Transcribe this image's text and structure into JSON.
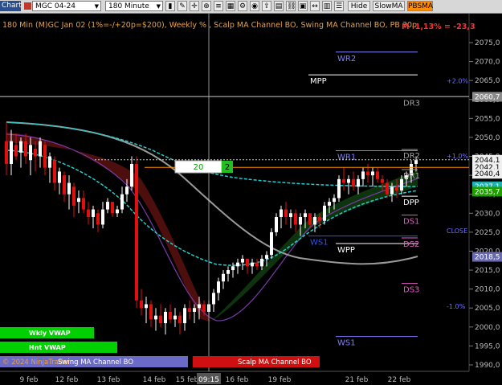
{
  "toolbar": {
    "tab_label": "Chart",
    "instrument": "MGC 04-24",
    "interval": "180 Minute",
    "buttons": [
      "Hide",
      "SlowMA",
      "PBSMA"
    ],
    "active_button": "PBSMA"
  },
  "chart_header": {
    "title": "180 Min (M)GC Jan 02 (1%=-/+20p=$200), Weekly % , Scalp MA Channel BO, Swing MA Channel BO, PB 30p",
    "status": "M -1,13% = -23,3"
  },
  "price_axis": {
    "ticks": [
      "2075,0",
      "2070,0",
      "2065,0",
      "2060,0",
      "2055,0",
      "2050,0",
      "2045,0",
      "2040,0",
      "2035,0",
      "2030,0",
      "2025,0",
      "2020,0",
      "2015,0",
      "2010,0",
      "2005,0",
      "2000,0",
      "1995,0",
      "1990,0"
    ],
    "tick_values": [
      2075,
      2070,
      2065,
      2060,
      2055,
      2050,
      2045,
      2040,
      2035,
      2030,
      2025,
      2020,
      2015,
      2010,
      2005,
      2000,
      1995,
      1990
    ],
    "markers": [
      {
        "label": "2060,7",
        "value": 2060.7,
        "color": "#b0b0b0"
      },
      {
        "label": "2044,1",
        "value": 2044.1,
        "color": "#ffffff"
      },
      {
        "label": "2042,1",
        "value": 2042.1,
        "color": "#ffffff"
      },
      {
        "label": "2040,4",
        "value": 2040.4,
        "color": "#ffffff"
      },
      {
        "label": "2037,1",
        "value": 2037.1,
        "color": "#20c0c0"
      },
      {
        "label": "2035,7",
        "value": 2035.7,
        "color": "#20c000"
      },
      {
        "label": "2018,5",
        "value": 2018.5,
        "color": "#8080c0"
      }
    ]
  },
  "time_axis": {
    "labels": [
      "9 feb",
      "12 feb",
      "13 feb",
      "14 feb",
      "15 feb",
      "16 feb",
      "19 feb",
      "21 feb",
      "22 feb"
    ],
    "crosshair_time": "09:15"
  },
  "levels": [
    {
      "label": "WR2",
      "value": 2072.5
    },
    {
      "label": "MPP",
      "value": 2066.5
    },
    {
      "label": "DR3",
      "value": 2060.7
    },
    {
      "label": "WR1",
      "value": 2046.5
    },
    {
      "label": "DR2",
      "value": 2046.8
    },
    {
      "label": "DR1",
      "value": 2041.5
    },
    {
      "label": "DPP",
      "value": 2034.5
    },
    {
      "label": "DS1",
      "value": 2029.5
    },
    {
      "label": "WS1",
      "value": 2024.0
    },
    {
      "label": "WPP",
      "value": 2022.0
    },
    {
      "label": "DS2",
      "value": 2023.5
    },
    {
      "label": "DS3",
      "value": 2011.5
    },
    {
      "label": "WS1",
      "value": 1997.5
    }
  ],
  "percent_labels": [
    {
      "label": "+2.0%",
      "value": 2064.3
    },
    {
      "label": "+1,0%",
      "value": 2044.5
    },
    {
      "label": "CLOSE",
      "value": 2024.8
    },
    {
      "label": "-1.0%",
      "value": 2004.8
    }
  ],
  "order_box": {
    "qty": "20",
    "count": "2"
  },
  "indicator_badges": [
    {
      "label": "Wkly VWAP",
      "color": "#00d000"
    },
    {
      "label": "Hnt VWAP",
      "color": "#00d000"
    }
  ],
  "bottom_bar": {
    "copyright": "© 2024 NinjaTrader",
    "swing_label": "Swing MA Channel BO",
    "scalp_label": "Scalp MA Channel BO"
  },
  "colors": {
    "up": "#ffffff",
    "down": "#e01010",
    "cyan": "#20d0d0",
    "slow_ma": "#9a9a9a",
    "channel_red": "#5a1010",
    "channel_green": "#0f3a0f",
    "accent": "#ff8c00"
  }
}
